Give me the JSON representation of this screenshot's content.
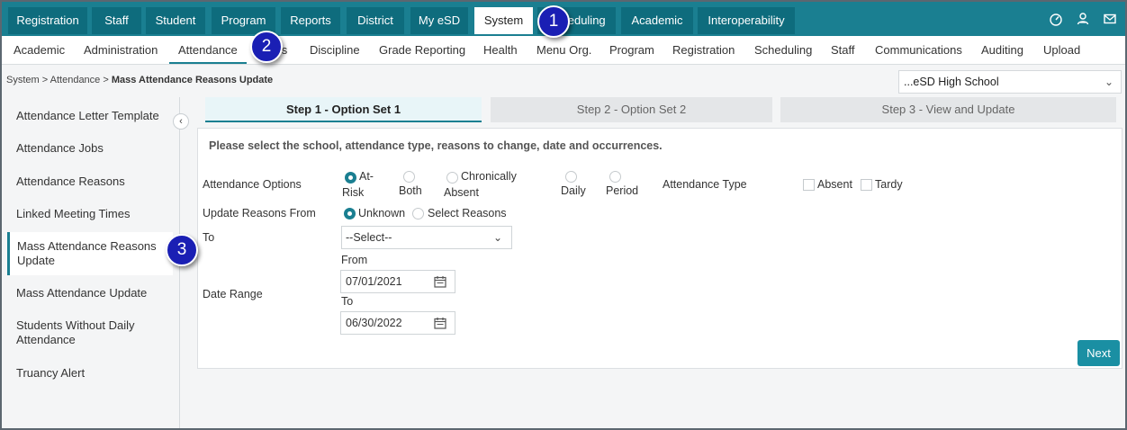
{
  "top_nav": {
    "tabs": [
      {
        "label": "Registration"
      },
      {
        "label": "Staff"
      },
      {
        "label": "Student"
      },
      {
        "label": "Program"
      },
      {
        "label": "Reports"
      },
      {
        "label": "District"
      },
      {
        "label": "My eSD"
      },
      {
        "label": "System",
        "active": true
      },
      {
        "label": "Scheduling"
      },
      {
        "label": "Academic"
      },
      {
        "label": "Interoperability"
      }
    ],
    "icons": [
      "dashboard-icon",
      "user-icon",
      "mail-icon"
    ]
  },
  "sub_nav": {
    "tabs": [
      {
        "label": "Academic"
      },
      {
        "label": "Administration"
      },
      {
        "label": "Attendance",
        "active": true
      },
      {
        "label": "Rules"
      },
      {
        "label": "Discipline"
      },
      {
        "label": "Grade Reporting"
      },
      {
        "label": "Health"
      },
      {
        "label": "Menu Org."
      },
      {
        "label": "Program"
      },
      {
        "label": "Registration"
      },
      {
        "label": "Scheduling"
      },
      {
        "label": "Staff"
      },
      {
        "label": "Communications"
      },
      {
        "label": "Auditing"
      },
      {
        "label": "Upload"
      }
    ]
  },
  "breadcrumb": {
    "items": [
      "System",
      "Attendance"
    ],
    "current": "Mass Attendance Reasons Update",
    "separator": ">"
  },
  "school_select": {
    "value": "...eSD High School"
  },
  "sidebar": {
    "items": [
      {
        "label": "Attendance Letter Template"
      },
      {
        "label": "Attendance Jobs"
      },
      {
        "label": "Attendance Reasons"
      },
      {
        "label": "Linked Meeting Times"
      },
      {
        "label": "Mass Attendance Reasons Update",
        "active": true
      },
      {
        "label": "Mass Attendance Update"
      },
      {
        "label": "Students Without Daily Attendance"
      },
      {
        "label": "Truancy Alert"
      }
    ],
    "collapse_icon": "chevron-left-icon"
  },
  "steps": [
    {
      "label": "Step 1 - Option Set 1",
      "active": true
    },
    {
      "label": "Step 2 - Option Set 2"
    },
    {
      "label": "Step 3 - View and Update"
    }
  ],
  "form": {
    "instruction": "Please select the school, attendance type, reasons to change, date and occurrences.",
    "attendance_options": {
      "label": "Attendance Options",
      "options": [
        {
          "label_line1": "At-",
          "label_line2": "Risk",
          "selected": true
        },
        {
          "label_line1": "",
          "label_line2": "Both",
          "selected": false
        },
        {
          "label_line1": "Chronically",
          "label_line2": "Absent",
          "selected": false
        },
        {
          "label_line1": "",
          "label_line2": "Daily",
          "selected": false
        },
        {
          "label_line1": "",
          "label_line2": "Period",
          "selected": false
        }
      ]
    },
    "attendance_type": {
      "label": "Attendance Type",
      "options": [
        {
          "label": "Absent",
          "checked": false
        },
        {
          "label": "Tardy",
          "checked": false
        }
      ]
    },
    "update_reasons_from": {
      "label": "Update Reasons From",
      "options": [
        {
          "label": "Unknown",
          "selected": true
        },
        {
          "label": "Select Reasons",
          "selected": false
        }
      ]
    },
    "to": {
      "label": "To",
      "value": "--Select--"
    },
    "date_range": {
      "label": "Date Range",
      "from_label": "From",
      "from_value": "07/01/2021",
      "to_label": "To",
      "to_value": "06/30/2022"
    },
    "next_label": "Next"
  },
  "callouts": [
    "1",
    "2",
    "3"
  ],
  "colors": {
    "accent": "#1a7f91",
    "topnav": "#1a7f91",
    "tab_dark": "#0e6c7d",
    "callout": "#1a1fb4"
  }
}
